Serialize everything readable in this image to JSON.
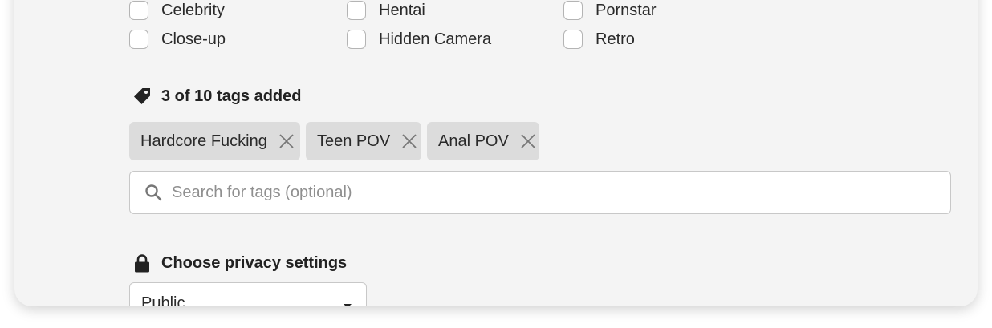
{
  "categories": [
    {
      "label": "Celebrity",
      "checked": false
    },
    {
      "label": "Hentai",
      "checked": false
    },
    {
      "label": "Pornstar",
      "checked": false
    },
    {
      "label": "Close-up",
      "checked": false
    },
    {
      "label": "Hidden Camera",
      "checked": false
    },
    {
      "label": "Retro",
      "checked": false
    }
  ],
  "tags": {
    "heading": "3 of 10 tags added",
    "icon": "tag-icon",
    "items": [
      "Hardcore Fucking",
      "Teen POV",
      "Anal POV"
    ],
    "search_placeholder": "Search for tags (optional)"
  },
  "privacy": {
    "heading": "Choose privacy settings",
    "icon": "lock-icon",
    "selected": "Public"
  }
}
